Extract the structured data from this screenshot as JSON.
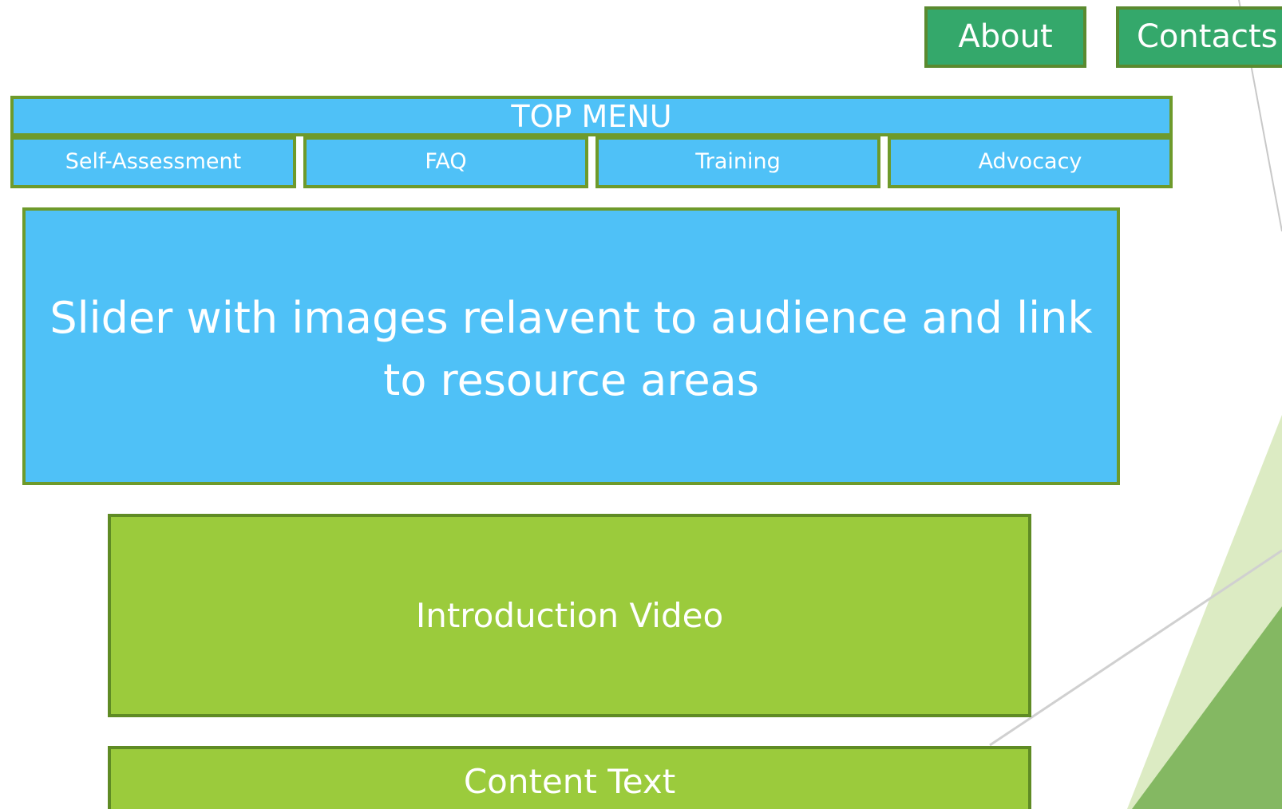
{
  "nav": {
    "about_label": "About",
    "contacts_label": "Contacts"
  },
  "top_menu": {
    "title": "TOP MENU",
    "items": [
      {
        "label": "Self-Assessment"
      },
      {
        "label": "FAQ"
      },
      {
        "label": "Training"
      },
      {
        "label": "Advocacy"
      }
    ]
  },
  "slider": {
    "text": "Slider with images relavent to audience and link to resource areas"
  },
  "intro_video": {
    "label": "Introduction Video"
  },
  "content_text": {
    "label": "Content Text"
  },
  "colors": {
    "nav_button": "#34a86b",
    "menu_blue": "#4fc1f7",
    "content_green": "#9bcb3c",
    "border_green": "#6e9a2b"
  }
}
